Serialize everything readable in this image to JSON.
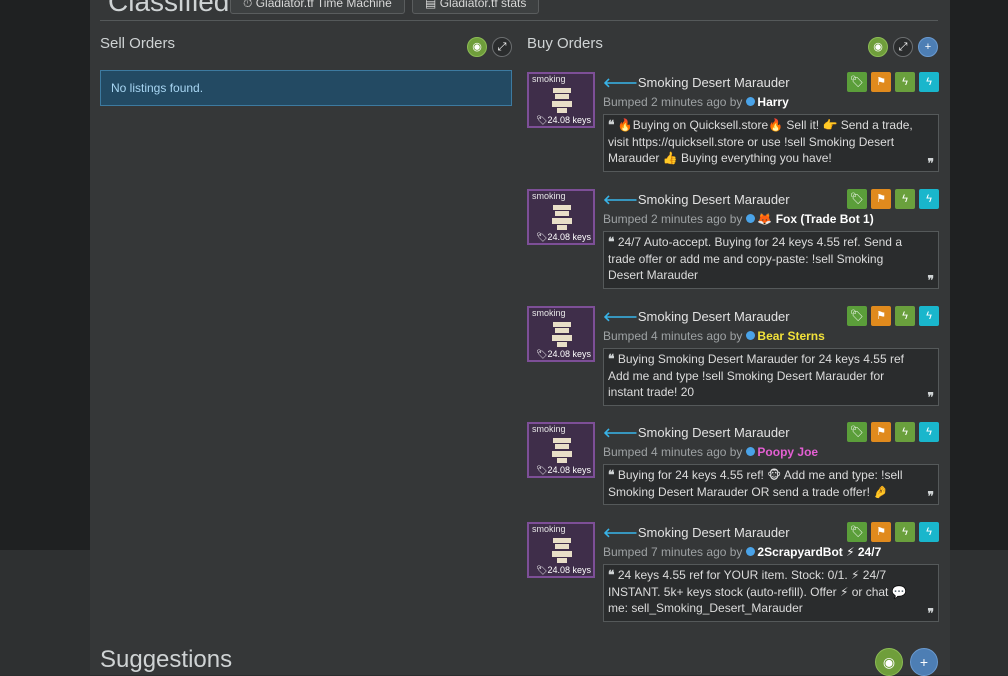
{
  "header": {
    "title": "Classifieds",
    "buttons": [
      {
        "icon": "clock-icon",
        "label": "Gladiator.tf Time Machine"
      },
      {
        "icon": "chart-icon",
        "label": "Gladiator.tf stats"
      }
    ]
  },
  "sell_orders": {
    "title": "Sell Orders",
    "empty_message": "No listings found."
  },
  "buy_orders": {
    "title": "Buy Orders",
    "listings": [
      {
        "quality": "smoking",
        "price": "24.08 keys",
        "item": "Smoking Desert Marauder",
        "bumped": "Bumped 2 minutes ago by",
        "user": "Harry",
        "user_color": "#ffffff",
        "message": "🔥Buying on Quicksell.store🔥 Sell it! 👉 Send a trade, visit https://quicksell.store or use !sell Smoking Desert Marauder 👍 Buying everything you have!"
      },
      {
        "quality": "smoking",
        "price": "24.08 keys",
        "item": "Smoking Desert Marauder",
        "bumped": "Bumped 2 minutes ago by",
        "user": "🦊 Fox (Trade Bot 1)",
        "user_color": "#ffffff",
        "message": "24/7 Auto-accept. Buying for 24 keys 4.55 ref. Send a trade offer or add me and copy-paste: !sell Smoking Desert Marauder"
      },
      {
        "quality": "smoking",
        "price": "24.08 keys",
        "item": "Smoking Desert Marauder",
        "bumped": "Bumped 4 minutes ago by",
        "user": "Bear Sterns",
        "user_color": "#f2e13a",
        "message": "Buying Smoking Desert Marauder for 24 keys 4.55 ref Add me and type !sell Smoking Desert Marauder for instant trade! 20"
      },
      {
        "quality": "smoking",
        "price": "24.08 keys",
        "item": "Smoking Desert Marauder",
        "bumped": "Bumped 4 minutes ago by",
        "user": "Poopy Joe",
        "user_color": "#e45fd3",
        "message": "Buying for 24 keys 4.55 ref! 🐵 Add me and type: !sell Smoking Desert Marauder OR send a trade offer! 🤌"
      },
      {
        "quality": "smoking",
        "price": "24.08 keys",
        "item": "Smoking Desert Marauder",
        "bumped": "Bumped 7 minutes ago by",
        "user": "2ScrapyardBot ⚡ 24/7",
        "user_color": "#ffffff",
        "message": "24 keys 4.55 ref for YOUR item. Stock: 0/1. ⚡ 24/7 INSTANT. 5k+ keys stock (auto-refill). Offer ⚡ or chat 💬 me: sell_Smoking_Desert_Marauder"
      }
    ]
  },
  "suggestions": {
    "title": "Suggestions"
  },
  "colors": {
    "quality_border": "#7d4f97",
    "accent_arrow": "#38b4e8"
  },
  "icons": {
    "hide": "eye-slash-icon",
    "expand": "expand-icon",
    "add": "plus-icon",
    "tag": "tag-icon",
    "flag": "flag-icon",
    "bolt": "bolt-icon",
    "arrow": "arrow-left-icon"
  }
}
